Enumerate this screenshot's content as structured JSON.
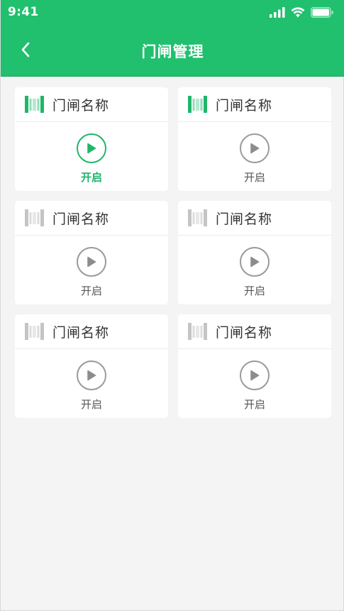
{
  "status_bar": {
    "time": "9:41"
  },
  "header": {
    "title": "门闸管理"
  },
  "colors": {
    "brand": "#20c06e",
    "active": "#20b66a",
    "inactive": "#9a9a9a"
  },
  "gates": [
    {
      "name": "门闸名称",
      "action_label": "开启",
      "state": "active"
    },
    {
      "name": "门闸名称",
      "action_label": "开启",
      "state": "online"
    },
    {
      "name": "门闸名称",
      "action_label": "开启",
      "state": "offline"
    },
    {
      "name": "门闸名称",
      "action_label": "开启",
      "state": "offline"
    },
    {
      "name": "门闸名称",
      "action_label": "开启",
      "state": "offline"
    },
    {
      "name": "门闸名称",
      "action_label": "开启",
      "state": "offline"
    }
  ]
}
